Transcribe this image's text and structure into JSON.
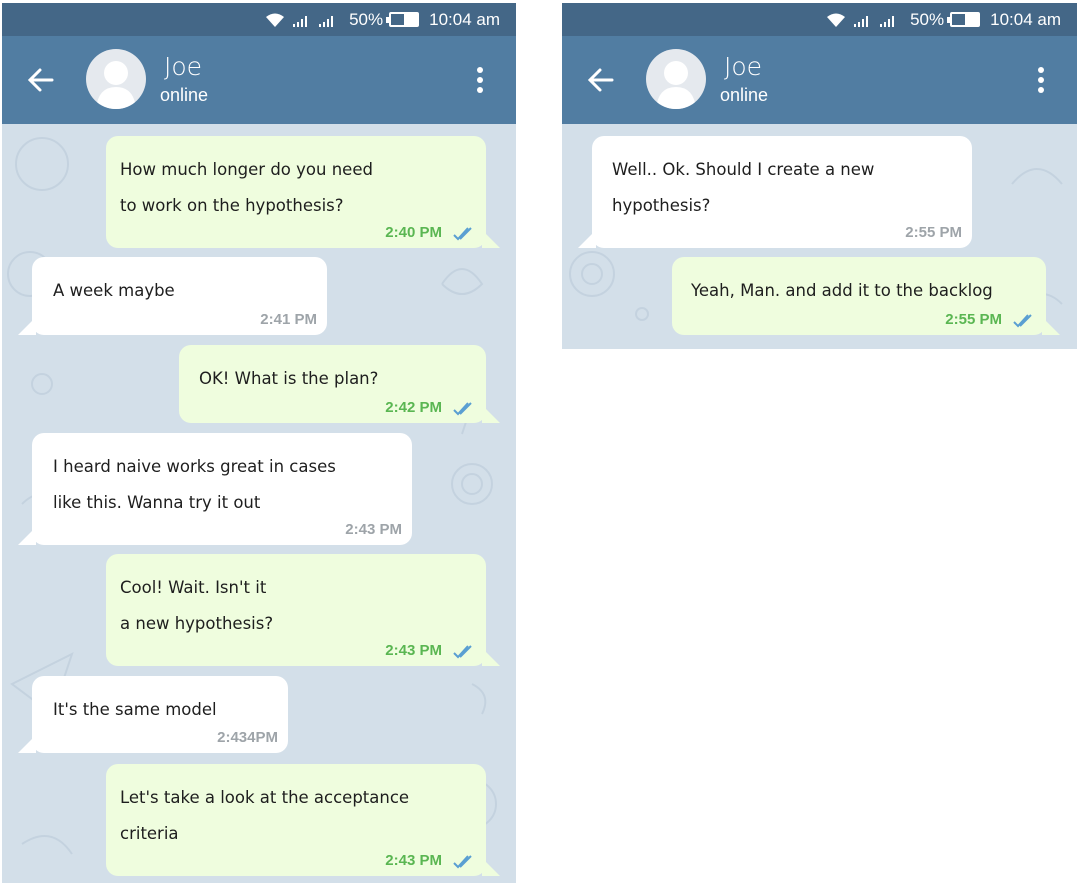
{
  "status_bar": {
    "battery_percent": "50%",
    "battery_level": 0.5,
    "time": "10:04 am"
  },
  "header": {
    "contact_name": "Joe",
    "contact_status": "online"
  },
  "colors": {
    "header": "#517da2",
    "status_bar": "#446787",
    "outgoing_bubble": "#effdde",
    "incoming_bubble": "#ffffff",
    "outgoing_time": "#5ab652",
    "check_marks": "#5a9fd2"
  },
  "icons": {
    "back": "arrow-left-icon",
    "menu": "more-vertical-icon",
    "read": "double-check-icon",
    "wifi": "wifi-icon",
    "signal": "signal-icon",
    "battery": "battery-icon",
    "avatar": "user-avatar-icon"
  },
  "screen1": {
    "messages": [
      {
        "direction": "out",
        "text": "How much longer do you need\nto work on the hypothesis?",
        "time": "2:40 PM"
      },
      {
        "direction": "in",
        "text": "A week maybe",
        "time": "2:41 PM"
      },
      {
        "direction": "out",
        "text": "OK! What is the plan?",
        "time": "2:42 PM"
      },
      {
        "direction": "in",
        "text": "I heard naive works great in cases\nlike this. Wanna try it out",
        "time": "2:43 PM"
      },
      {
        "direction": "out",
        "text": "Cool! Wait. Isn't it\na new hypothesis?",
        "time": "2:43 PM"
      },
      {
        "direction": "in",
        "text": "It's the same model",
        "time": "2:434PM"
      },
      {
        "direction": "out",
        "text": "Let's take a look at the acceptance\ncriteria",
        "time": "2:43 PM"
      }
    ]
  },
  "screen2": {
    "messages": [
      {
        "direction": "in",
        "text": "Well.. Ok. Should I create a new\nhypothesis?",
        "time": "2:55 PM"
      },
      {
        "direction": "out",
        "text": "Yeah, Man. and add it to the backlog",
        "time": "2:55 PM"
      }
    ]
  }
}
